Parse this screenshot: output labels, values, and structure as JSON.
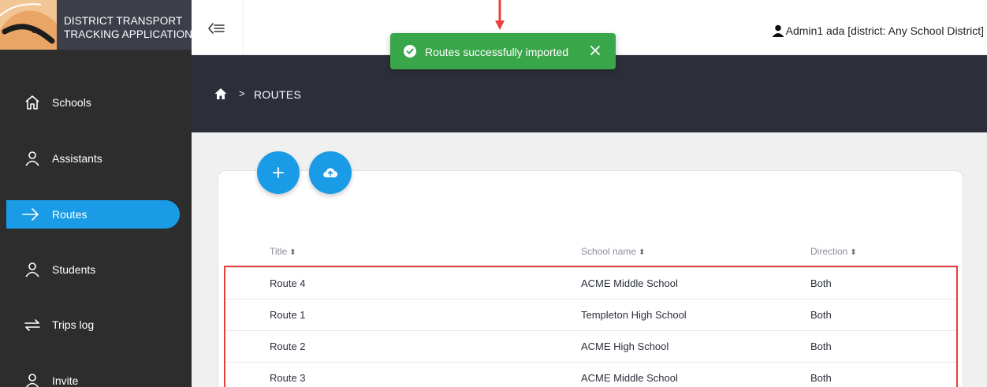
{
  "app": {
    "brand_line1": "DISTRICT TRANSPORT",
    "brand_line2": "TRACKING APPLICATION"
  },
  "sidebar": {
    "items": [
      {
        "label": "Schools",
        "icon": "home-outline-icon",
        "active": false
      },
      {
        "label": "Assistants",
        "icon": "person-outline-icon",
        "active": false
      },
      {
        "label": "Routes",
        "icon": "arrow-right-icon",
        "active": true
      },
      {
        "label": "Students",
        "icon": "person-outline-icon",
        "active": false
      },
      {
        "label": "Trips log",
        "icon": "swap-arrows-icon",
        "active": false
      },
      {
        "label": "Invite",
        "icon": "person-outline-icon",
        "active": false
      }
    ]
  },
  "header": {
    "user": "Admin1 ada [district: Any School District]"
  },
  "breadcrumb": {
    "separator": ">",
    "current": "ROUTES"
  },
  "toast": {
    "message": "Routes successfully imported"
  },
  "table": {
    "columns": [
      "Title",
      "School name",
      "Direction"
    ],
    "sort_glyph": "⬍",
    "rows": [
      {
        "title": "Route 4",
        "school": "ACME Middle School",
        "direction": "Both"
      },
      {
        "title": "Route 1",
        "school": "Templeton High School",
        "direction": "Both"
      },
      {
        "title": "Route 2",
        "school": "ACME High School",
        "direction": "Both"
      },
      {
        "title": "Route 3",
        "school": "ACME Middle School",
        "direction": "Both"
      }
    ]
  },
  "colors": {
    "accent": "#1a9be6",
    "sidebar_bg": "#2d2d2d",
    "header_band": "#2c2f3a",
    "toast_success": "#3aa64a",
    "highlight": "#e8403c"
  }
}
